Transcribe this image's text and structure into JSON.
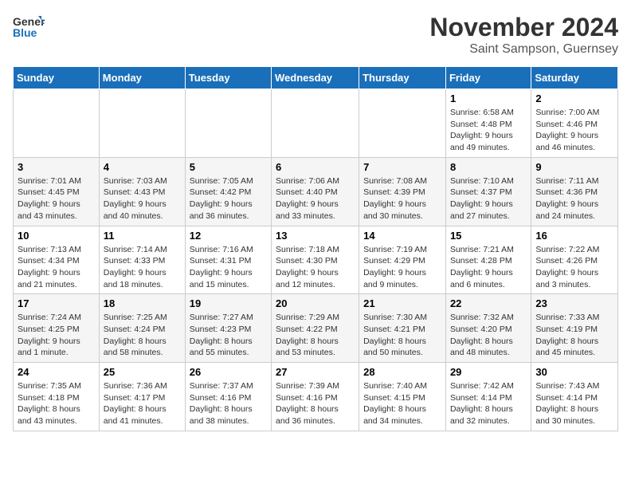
{
  "header": {
    "logo_line1": "General",
    "logo_line2": "Blue",
    "month_year": "November 2024",
    "location": "Saint Sampson, Guernsey"
  },
  "weekdays": [
    "Sunday",
    "Monday",
    "Tuesday",
    "Wednesday",
    "Thursday",
    "Friday",
    "Saturday"
  ],
  "weeks": [
    [
      {
        "day": "",
        "info": ""
      },
      {
        "day": "",
        "info": ""
      },
      {
        "day": "",
        "info": ""
      },
      {
        "day": "",
        "info": ""
      },
      {
        "day": "",
        "info": ""
      },
      {
        "day": "1",
        "info": "Sunrise: 6:58 AM\nSunset: 4:48 PM\nDaylight: 9 hours\nand 49 minutes."
      },
      {
        "day": "2",
        "info": "Sunrise: 7:00 AM\nSunset: 4:46 PM\nDaylight: 9 hours\nand 46 minutes."
      }
    ],
    [
      {
        "day": "3",
        "info": "Sunrise: 7:01 AM\nSunset: 4:45 PM\nDaylight: 9 hours\nand 43 minutes."
      },
      {
        "day": "4",
        "info": "Sunrise: 7:03 AM\nSunset: 4:43 PM\nDaylight: 9 hours\nand 40 minutes."
      },
      {
        "day": "5",
        "info": "Sunrise: 7:05 AM\nSunset: 4:42 PM\nDaylight: 9 hours\nand 36 minutes."
      },
      {
        "day": "6",
        "info": "Sunrise: 7:06 AM\nSunset: 4:40 PM\nDaylight: 9 hours\nand 33 minutes."
      },
      {
        "day": "7",
        "info": "Sunrise: 7:08 AM\nSunset: 4:39 PM\nDaylight: 9 hours\nand 30 minutes."
      },
      {
        "day": "8",
        "info": "Sunrise: 7:10 AM\nSunset: 4:37 PM\nDaylight: 9 hours\nand 27 minutes."
      },
      {
        "day": "9",
        "info": "Sunrise: 7:11 AM\nSunset: 4:36 PM\nDaylight: 9 hours\nand 24 minutes."
      }
    ],
    [
      {
        "day": "10",
        "info": "Sunrise: 7:13 AM\nSunset: 4:34 PM\nDaylight: 9 hours\nand 21 minutes."
      },
      {
        "day": "11",
        "info": "Sunrise: 7:14 AM\nSunset: 4:33 PM\nDaylight: 9 hours\nand 18 minutes."
      },
      {
        "day": "12",
        "info": "Sunrise: 7:16 AM\nSunset: 4:31 PM\nDaylight: 9 hours\nand 15 minutes."
      },
      {
        "day": "13",
        "info": "Sunrise: 7:18 AM\nSunset: 4:30 PM\nDaylight: 9 hours\nand 12 minutes."
      },
      {
        "day": "14",
        "info": "Sunrise: 7:19 AM\nSunset: 4:29 PM\nDaylight: 9 hours\nand 9 minutes."
      },
      {
        "day": "15",
        "info": "Sunrise: 7:21 AM\nSunset: 4:28 PM\nDaylight: 9 hours\nand 6 minutes."
      },
      {
        "day": "16",
        "info": "Sunrise: 7:22 AM\nSunset: 4:26 PM\nDaylight: 9 hours\nand 3 minutes."
      }
    ],
    [
      {
        "day": "17",
        "info": "Sunrise: 7:24 AM\nSunset: 4:25 PM\nDaylight: 9 hours\nand 1 minute."
      },
      {
        "day": "18",
        "info": "Sunrise: 7:25 AM\nSunset: 4:24 PM\nDaylight: 8 hours\nand 58 minutes."
      },
      {
        "day": "19",
        "info": "Sunrise: 7:27 AM\nSunset: 4:23 PM\nDaylight: 8 hours\nand 55 minutes."
      },
      {
        "day": "20",
        "info": "Sunrise: 7:29 AM\nSunset: 4:22 PM\nDaylight: 8 hours\nand 53 minutes."
      },
      {
        "day": "21",
        "info": "Sunrise: 7:30 AM\nSunset: 4:21 PM\nDaylight: 8 hours\nand 50 minutes."
      },
      {
        "day": "22",
        "info": "Sunrise: 7:32 AM\nSunset: 4:20 PM\nDaylight: 8 hours\nand 48 minutes."
      },
      {
        "day": "23",
        "info": "Sunrise: 7:33 AM\nSunset: 4:19 PM\nDaylight: 8 hours\nand 45 minutes."
      }
    ],
    [
      {
        "day": "24",
        "info": "Sunrise: 7:35 AM\nSunset: 4:18 PM\nDaylight: 8 hours\nand 43 minutes."
      },
      {
        "day": "25",
        "info": "Sunrise: 7:36 AM\nSunset: 4:17 PM\nDaylight: 8 hours\nand 41 minutes."
      },
      {
        "day": "26",
        "info": "Sunrise: 7:37 AM\nSunset: 4:16 PM\nDaylight: 8 hours\nand 38 minutes."
      },
      {
        "day": "27",
        "info": "Sunrise: 7:39 AM\nSunset: 4:16 PM\nDaylight: 8 hours\nand 36 minutes."
      },
      {
        "day": "28",
        "info": "Sunrise: 7:40 AM\nSunset: 4:15 PM\nDaylight: 8 hours\nand 34 minutes."
      },
      {
        "day": "29",
        "info": "Sunrise: 7:42 AM\nSunset: 4:14 PM\nDaylight: 8 hours\nand 32 minutes."
      },
      {
        "day": "30",
        "info": "Sunrise: 7:43 AM\nSunset: 4:14 PM\nDaylight: 8 hours\nand 30 minutes."
      }
    ]
  ]
}
